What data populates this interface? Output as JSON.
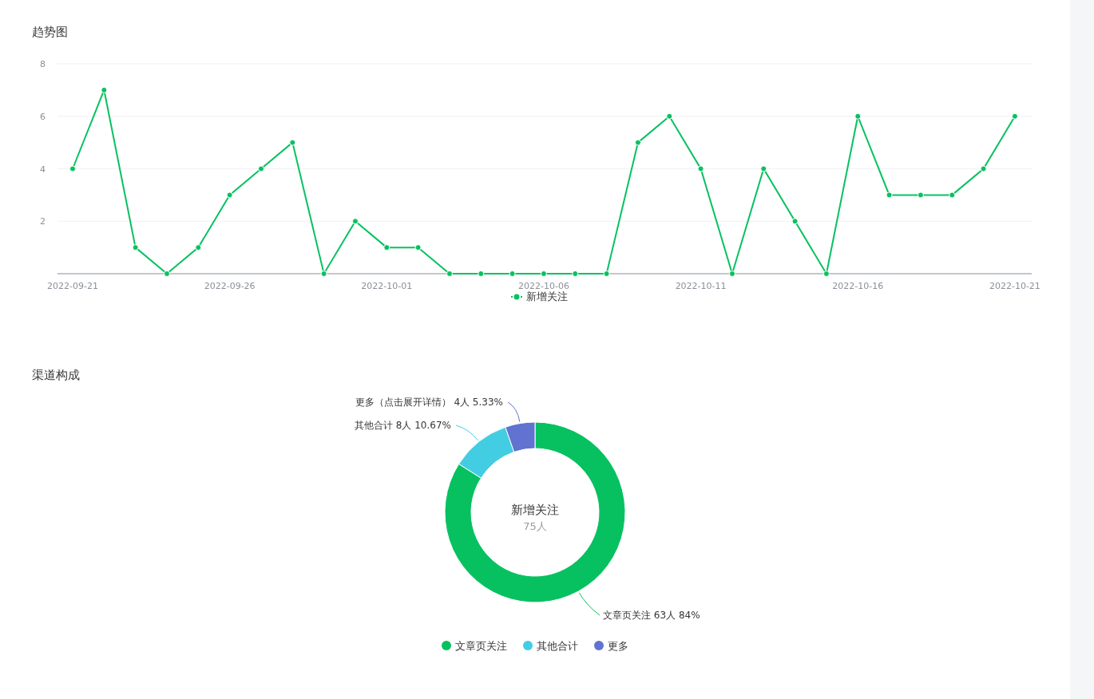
{
  "trend": {
    "title": "趋势图",
    "chart_data": {
      "type": "line",
      "categories": [
        "2022-09-21",
        null,
        null,
        null,
        null,
        "2022-09-26",
        null,
        null,
        null,
        null,
        "2022-10-01",
        null,
        null,
        null,
        null,
        "2022-10-06",
        null,
        null,
        null,
        null,
        "2022-10-11",
        null,
        null,
        null,
        null,
        "2022-10-16",
        null,
        null,
        null,
        null,
        "2022-10-21"
      ],
      "grid": true,
      "series": [
        {
          "name": "新增关注",
          "color": "#07c160",
          "marker": "circle",
          "values": [
            4,
            7,
            1,
            0,
            1,
            3,
            4,
            5,
            0,
            2,
            1,
            1,
            0,
            0,
            0,
            0,
            0,
            0,
            5,
            6,
            4,
            0,
            4,
            2,
            0,
            6,
            3,
            3,
            3,
            4,
            6
          ]
        }
      ],
      "ylim": [
        0,
        8
      ],
      "yticks": [
        2,
        4,
        6,
        8
      ]
    }
  },
  "channels": {
    "title": "渠道构成",
    "center_title": "新增关注",
    "center_value": "75人",
    "chart_data": {
      "type": "donut",
      "categories": [
        "文章页关注",
        "其他合计",
        "更多"
      ],
      "values": [
        84,
        10.67,
        5.33
      ],
      "value_labels": [
        "文章页关注 63人 84%",
        "其他合计 8人 10.67%",
        "更多（点击展开详情） 4人 5.33%"
      ]
    },
    "legend": [
      {
        "color": "#07c160"
      },
      {
        "color": "#43cde2"
      },
      {
        "color": "#6173d0"
      }
    ]
  }
}
